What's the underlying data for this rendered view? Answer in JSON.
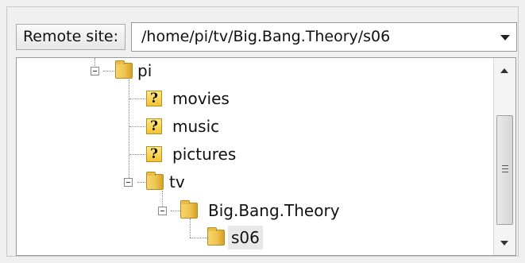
{
  "remote_site": {
    "label": "Remote site:",
    "path": "/home/pi/tv/Big.Bang.Theory/s06"
  },
  "tree": {
    "items": [
      {
        "label": "pi",
        "icon": "folder-icon"
      },
      {
        "label": "movies",
        "icon": "unknown-folder-icon"
      },
      {
        "label": "music",
        "icon": "unknown-folder-icon"
      },
      {
        "label": "pictures",
        "icon": "unknown-folder-icon"
      },
      {
        "label": "tv",
        "icon": "folder-icon"
      },
      {
        "label": "Big.Bang.Theory",
        "icon": "folder-icon"
      },
      {
        "label": "s06",
        "icon": "folder-icon",
        "selected": true
      }
    ]
  },
  "colors": {
    "folder": "#efc450",
    "selection": "#e8e8e8"
  }
}
